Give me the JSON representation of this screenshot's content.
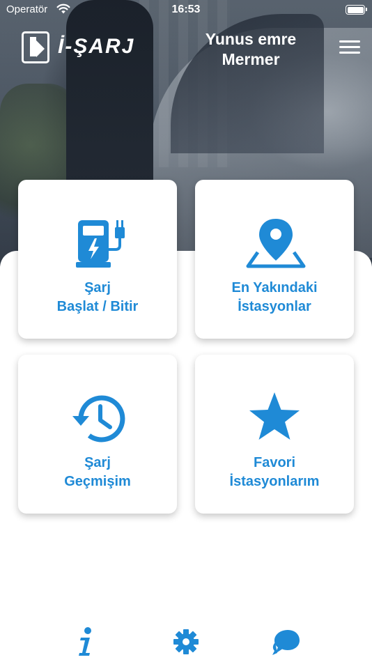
{
  "status_bar": {
    "carrier": "Operatör",
    "time": "16:53"
  },
  "header": {
    "logo_text": "İ-ŞARJ",
    "user_name_line1": "Yunus emre",
    "user_name_line2": "Mermer",
    "menu_icon": "hamburger-menu-icon"
  },
  "cards": [
    {
      "line1": "Şarj",
      "line2": "Başlat / Bitir",
      "icon": "charging-station-icon"
    },
    {
      "line1": "En Yakındaki",
      "line2": "İstasyonlar",
      "icon": "map-pin-icon"
    },
    {
      "line1": "Şarj",
      "line2": "Geçmişim",
      "icon": "history-icon"
    },
    {
      "line1": "Favori",
      "line2": "İstasyonlarım",
      "icon": "star-icon"
    }
  ],
  "tab_bar": {
    "items": [
      {
        "icon": "info-icon"
      },
      {
        "icon": "gear-icon"
      },
      {
        "icon": "chat-bubble-icon"
      }
    ]
  },
  "colors": {
    "accent": "#1f8ad6",
    "card_background": "#ffffff",
    "header_text": "#ffffff"
  }
}
